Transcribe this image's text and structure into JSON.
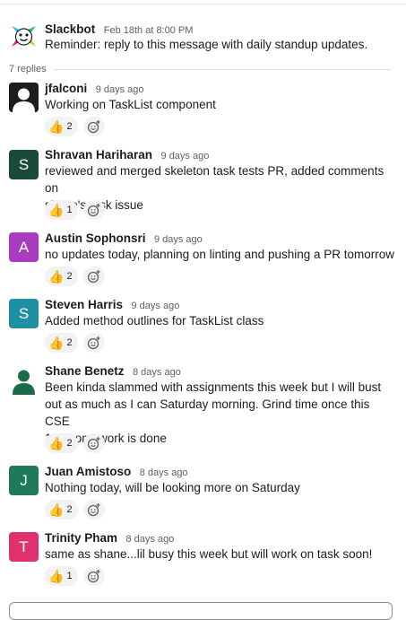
{
  "thread": {
    "replies_label": "7 replies"
  },
  "parent": {
    "name": "Slackbot",
    "time": "Feb 18th at 8:00 PM",
    "text": "Reminder: reply to this message with daily standup updates.",
    "avatar_icon": "slackbot-face-icon"
  },
  "messages": [
    {
      "name": "jfalconi",
      "time": "9 days ago",
      "text": "Working on TaskList component",
      "avatar_icon": "default-user-icon",
      "avatar_color": "#1d1c1d",
      "reaction": {
        "emoji": "👍",
        "count": "2"
      }
    },
    {
      "name": "Shravan Hariharan",
      "time": "9 days ago",
      "text_lines": [
        "reviewed and merged skeleton task tests PR, added comments on",
        "shane's task issue"
      ],
      "avatar_letter": "S",
      "avatar_color": "#1a4a3a",
      "reaction": {
        "emoji": "👍",
        "count": "1"
      }
    },
    {
      "name": "Austin Sophonsri",
      "time": "9 days ago",
      "text": "no updates today, planning on linting and pushing a PR tomorrow",
      "avatar_letter": "A",
      "avatar_color": "#a83bc0",
      "reaction": {
        "emoji": "👍",
        "count": "2"
      }
    },
    {
      "name": "Steven Harris",
      "time": "9 days ago",
      "text": "Added method outlines for TaskList class",
      "avatar_letter": "S",
      "avatar_color": "#1f8fa3",
      "reaction": {
        "emoji": "👍",
        "count": "2"
      }
    },
    {
      "name": "Shane Benetz",
      "time": "8 days ago",
      "text_lines": [
        "Been kinda slammed with assignments this week but I will bust",
        "out as much as I can Saturday morning. Grind time once this CSE",
        "101 homework is done"
      ],
      "avatar_icon": "default-user-icon",
      "avatar_color": "#1a6b4a",
      "reaction": {
        "emoji": "👍",
        "count": "2"
      }
    },
    {
      "name": "Juan Amistoso",
      "time": "8 days ago",
      "text": "Nothing today, will be looking more on Saturday",
      "avatar_letter": "J",
      "avatar_color": "#1d7a5c",
      "reaction": {
        "emoji": "👍",
        "count": "2"
      }
    },
    {
      "name": "Trinity Pham",
      "time": "8 days ago",
      "text": "same as shane...lil busy this week but will work on task soon!",
      "avatar_letter": "T",
      "avatar_color": "#e0306e",
      "reaction": {
        "emoji": "👍",
        "count": "1"
      }
    }
  ],
  "icons": {
    "add_reaction": "add-reaction-icon"
  }
}
